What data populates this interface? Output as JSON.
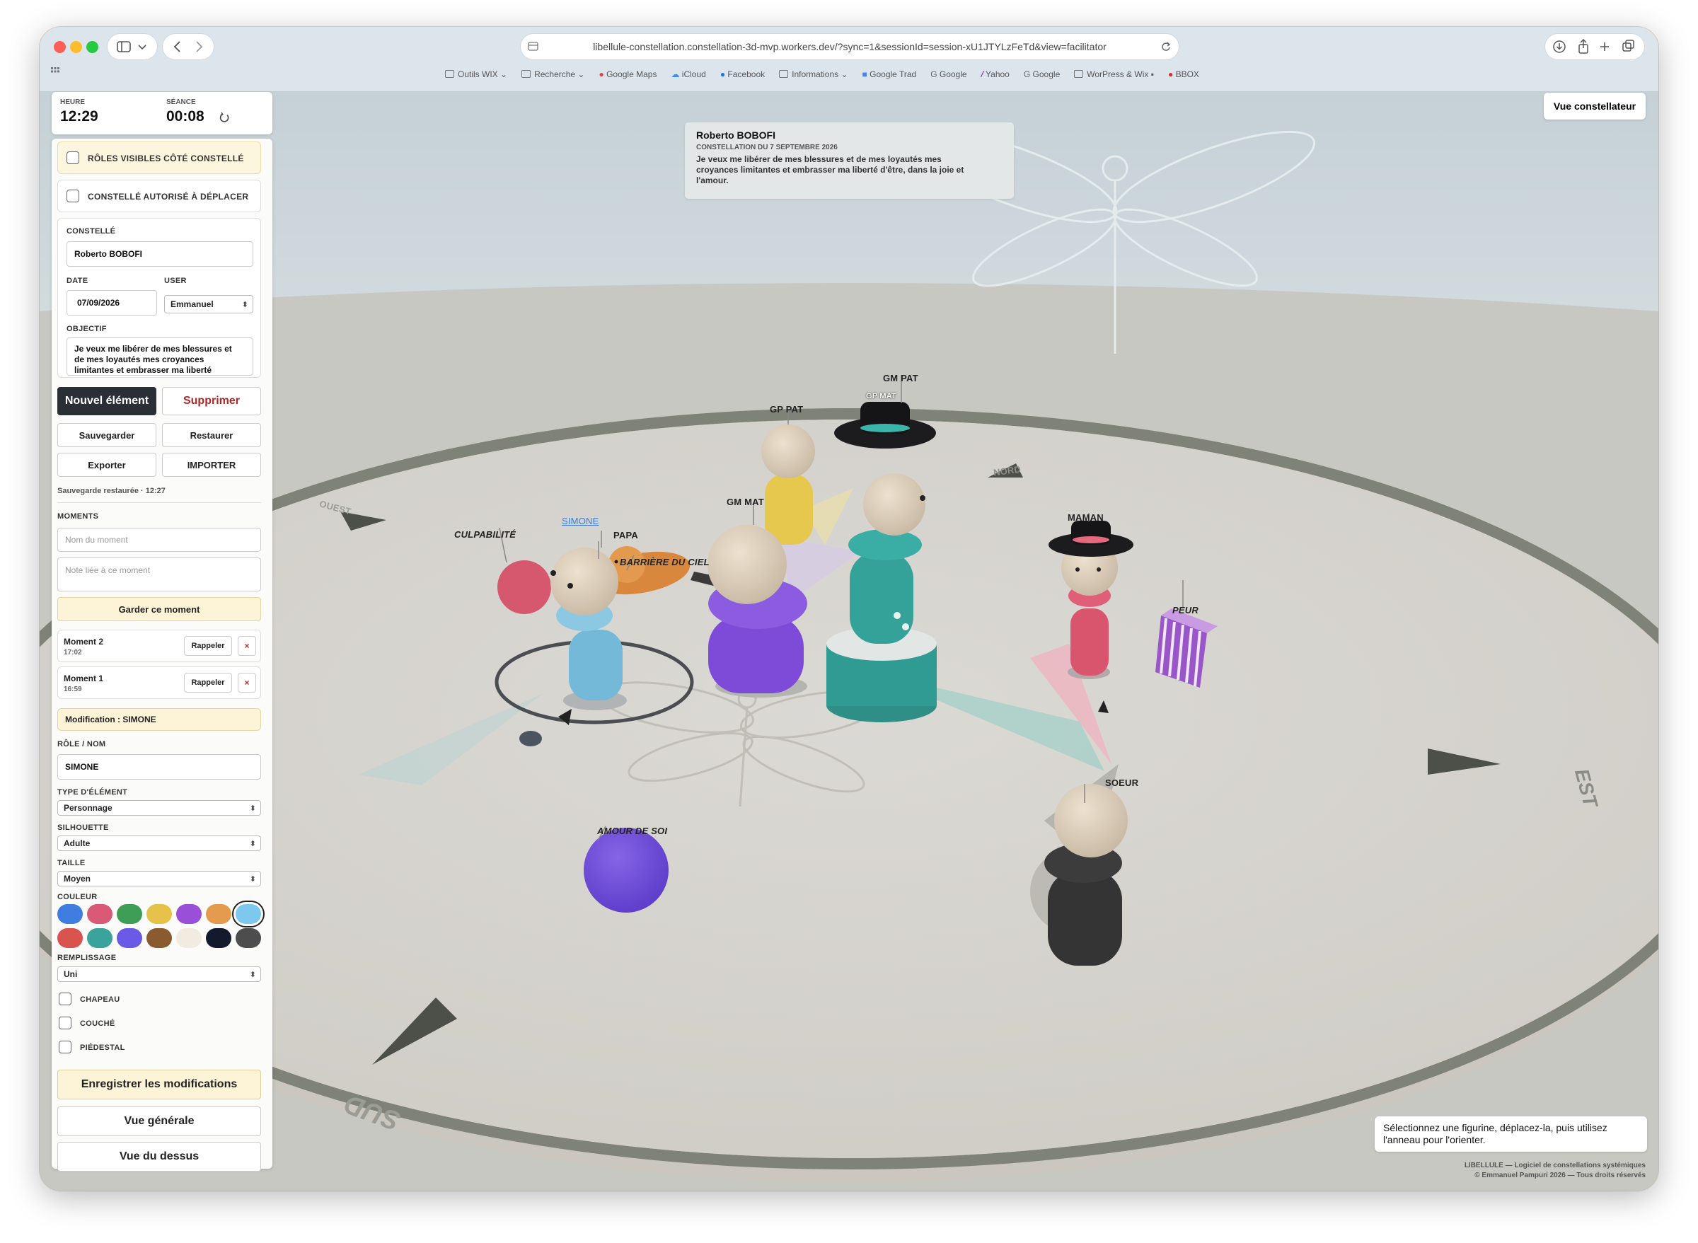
{
  "browser": {
    "url": "libellule-constellation.constellation-3d-mvp.workers.dev/?sync=1&sessionId=session-xU1JTYLzFeTd&view=facilitator",
    "bookmarks": [
      "Outils WIX",
      "Recherche",
      "Google Maps",
      "iCloud",
      "Facebook",
      "Informations",
      "Google Trad",
      "Google",
      "Yahoo",
      "Google",
      "WorPress & Wix",
      "BBOX"
    ]
  },
  "clock": {
    "heure_label": "HEURE",
    "heure_value": "12:29",
    "seance_label": "SÉANCE",
    "seance_value": "00:08"
  },
  "panel": {
    "roles_visible_label": "RÔLES VISIBLES CÔTÉ CONSTELLÉ",
    "constelle_move_label": "CONSTELLÉ AUTORISÉ À DÉPLACER",
    "constelle_label": "CONSTELLÉ",
    "constelle_value": "Roberto BOBOFI",
    "date_label": "DATE",
    "date_value": "07/09/2026",
    "user_label": "USER",
    "user_value": "Emmanuel",
    "objectif_label": "OBJECTIF",
    "objectif_line1": "Je veux me libérer de mes blessures et",
    "objectif_line2": "de mes loyautés mes croyances",
    "objectif_line3": "limitantes et embrasser ma liberté",
    "nouvel_element": "Nouvel élément",
    "supprimer": "Supprimer",
    "sauvegarder": "Sauvegarder",
    "restaurer": "Restaurer",
    "exporter": "Exporter",
    "importer": "IMPORTER",
    "save_status": "Sauvegarde restaurée · 12:27",
    "moments_label": "MOMENTS",
    "moment_name_placeholder": "Nom du moment",
    "moment_note_placeholder": "Note liée à ce moment",
    "garder_moment": "Garder ce moment",
    "moments": [
      {
        "name": "Moment 2",
        "time": "17:02",
        "recall": "Rappeler",
        "delete": "×"
      },
      {
        "name": "Moment 1",
        "time": "16:59",
        "recall": "Rappeler",
        "delete": "×"
      }
    ],
    "modification_label": "Modification : SIMONE",
    "role_label": "RÔLE / NOM",
    "role_value": "SIMONE",
    "type_label": "TYPE D'ÉLÉMENT",
    "type_value": "Personnage",
    "silhouette_label": "SILHOUETTE",
    "silhouette_value": "Adulte",
    "taille_label": "TAILLE",
    "taille_value": "Moyen",
    "couleur_label": "COULEUR",
    "colors_row1": [
      "#3f7ee0",
      "#d95a76",
      "#3f9e56",
      "#e6c24a",
      "#9a4fd8",
      "#e59b4e",
      "#7cc8ee"
    ],
    "colors_row2": [
      "#d9544f",
      "#3aa39b",
      "#6a5ae6",
      "#8a5a30",
      "#f1ecdf",
      "#141a2e",
      "#4d4d4d"
    ],
    "selected_color": "#7cc8ee",
    "remplissage_label": "REMPLISSAGE",
    "remplissage_value": "Uni",
    "chapeau_label": "CHAPEAU",
    "couche_label": "COUCHÉ",
    "piedestal_label": "PIÉDESTAL",
    "enregistrer": "Enregistrer les modifications",
    "vue_generale": "Vue générale",
    "vue_dessus": "Vue du dessus"
  },
  "session": {
    "name": "Roberto BOBOFI",
    "subtitle": "CONSTELLATION DU 7 SEPTEMBRE 2026",
    "objective_line1": "Je veux me libérer de mes blessures et de mes loyautés mes",
    "objective_line2": "croyances limitantes et embrasser ma liberté d'être, dans la joie et",
    "objective_line3": "l'amour."
  },
  "view_button": "Vue constellateur",
  "scene": {
    "labels": {
      "gm_pat": "GM PAT",
      "gp_pat": "GP PAT",
      "gp_mat_hat": "GP MAT",
      "gm_mat": "GM MAT",
      "maman": "MAMAN",
      "simone": "SIMONE",
      "culpabilite": "CULPABILITÉ",
      "papa": "PAPA",
      "barriere": "BARRIÈRE DU CIEL",
      "peur": "PEUR",
      "amour": "AMOUR DE SOI",
      "soeur": "SOEUR"
    },
    "compass": {
      "nord": "NORD",
      "ouest": "OUEST",
      "est": "EST",
      "sud": "SUD"
    }
  },
  "hint": {
    "line1": "Sélectionnez une figurine, déplacez-la, puis utilisez",
    "line2": "l'anneau pour l'orienter."
  },
  "footer": {
    "line1": "LIBELLULE — Logiciel de constellations systémiques",
    "line2": "© Emmanuel Pampuri 2026 — Tous droits réservés"
  }
}
